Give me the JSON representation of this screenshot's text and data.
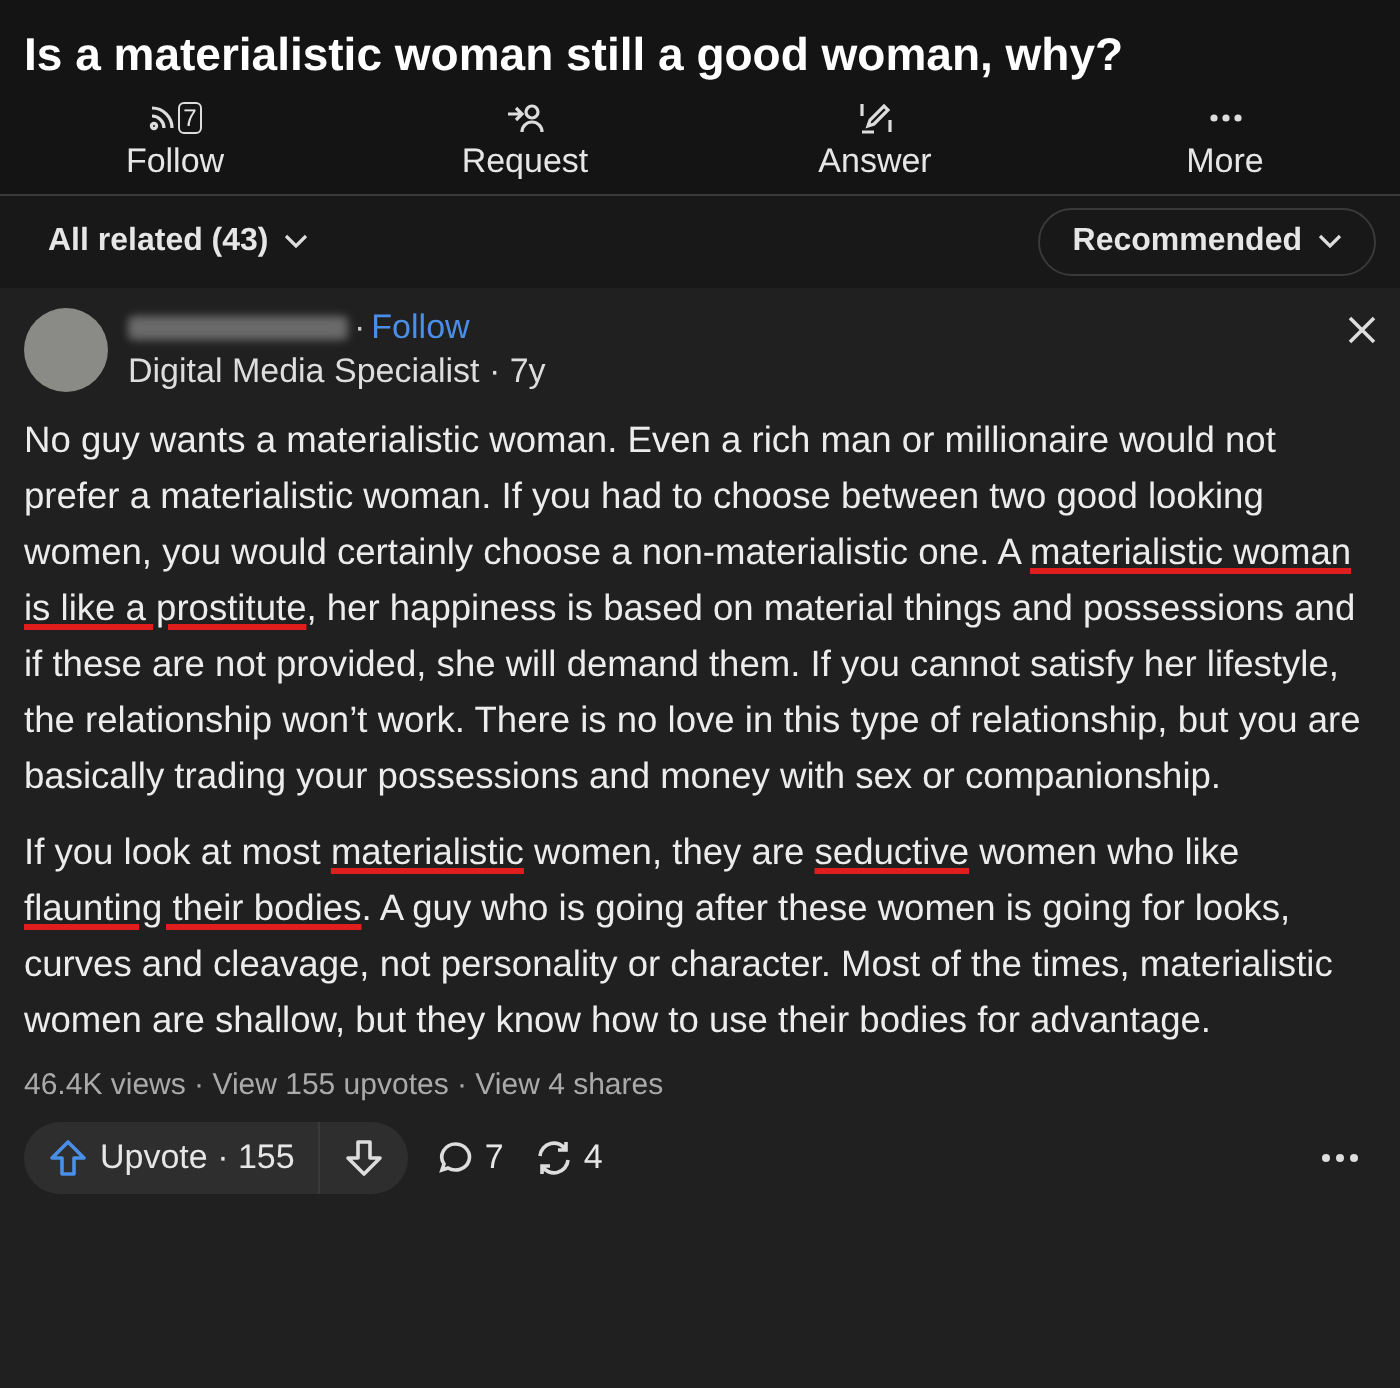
{
  "question": {
    "title": "Is a materialistic woman still a good woman, why?"
  },
  "actions": [
    {
      "kind": "follow",
      "label": "Follow",
      "badge": "7"
    },
    {
      "kind": "request",
      "label": "Request"
    },
    {
      "kind": "answer",
      "label": "Answer"
    },
    {
      "kind": "more",
      "label": "More"
    }
  ],
  "filter": {
    "label": "All related (43)",
    "sort": "Recommended"
  },
  "answer": {
    "separator": "·",
    "follow": "Follow",
    "credential": "Digital Media Specialist · 7y",
    "paragraphs": [
      [
        {
          "text": "No guy wants a materialistic woman. Even a rich man or millionaire would not prefer a materialistic woman. If you had to choose between two good looking women, you would certainly choose a non-materialistic one. A ",
          "underlined": false
        },
        {
          "text": "materialistic woman is like a prostitute",
          "underlined": true
        },
        {
          "text": ", her happiness is based on material things and possessions and if these are not provided, she will demand them. If you cannot satisfy her lifestyle, the relationship won’t work. There is no love in this type of relationship, but you are basically trading your possessions and money with sex or companionship.",
          "underlined": false
        }
      ],
      [
        {
          "text": "If you look at most ",
          "underlined": false
        },
        {
          "text": "materialistic",
          "underlined": true
        },
        {
          "text": " women, they are ",
          "underlined": false
        },
        {
          "text": "seductive",
          "underlined": true
        },
        {
          "text": " women who like ",
          "underlined": false
        },
        {
          "text": "flaunting their bodies",
          "underlined": true
        },
        {
          "text": ". A guy who is going after these women is going for looks, curves and cleavage, not personality or character. Most of the times, materialistic women are shallow, but they know how to use their bodies for advantage.",
          "underlined": false
        }
      ]
    ],
    "stats": "46.4K views · View 155 upvotes · View 4 shares",
    "upvote": "Upvote · 155",
    "comments": "7",
    "shares": "4"
  }
}
